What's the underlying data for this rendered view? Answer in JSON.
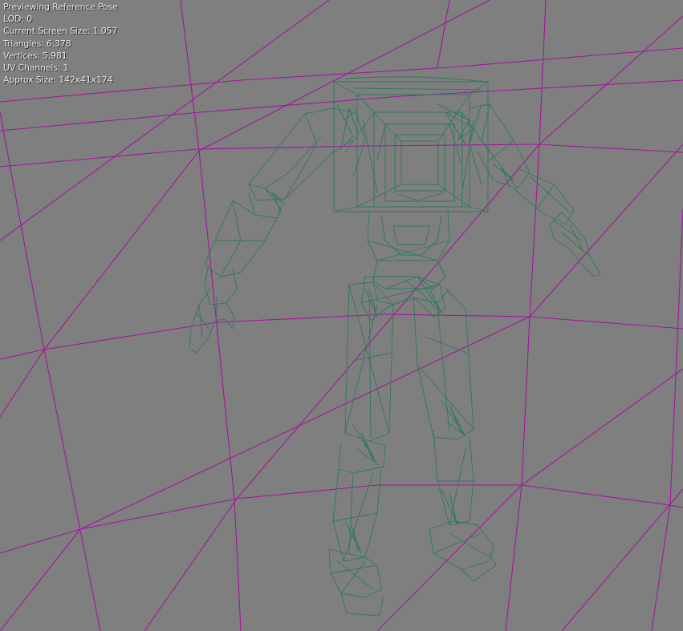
{
  "viewport": {
    "background_color": "#7f7f7f",
    "grid_color": "#a3169e",
    "wireframe_color": "#2e7a5c",
    "view_mode": "Wireframe"
  },
  "stats": {
    "preview_mode": "Previewing Reference Pose",
    "lod": "LOD: 0",
    "screen_size": "Current Screen Size: 1.057",
    "triangles": "Triangles: 6,378",
    "vertices": "Vertices: 5,981",
    "uv_channels": "UV Channels: 1",
    "approx_size": "Approx Size: 142x41x174"
  }
}
